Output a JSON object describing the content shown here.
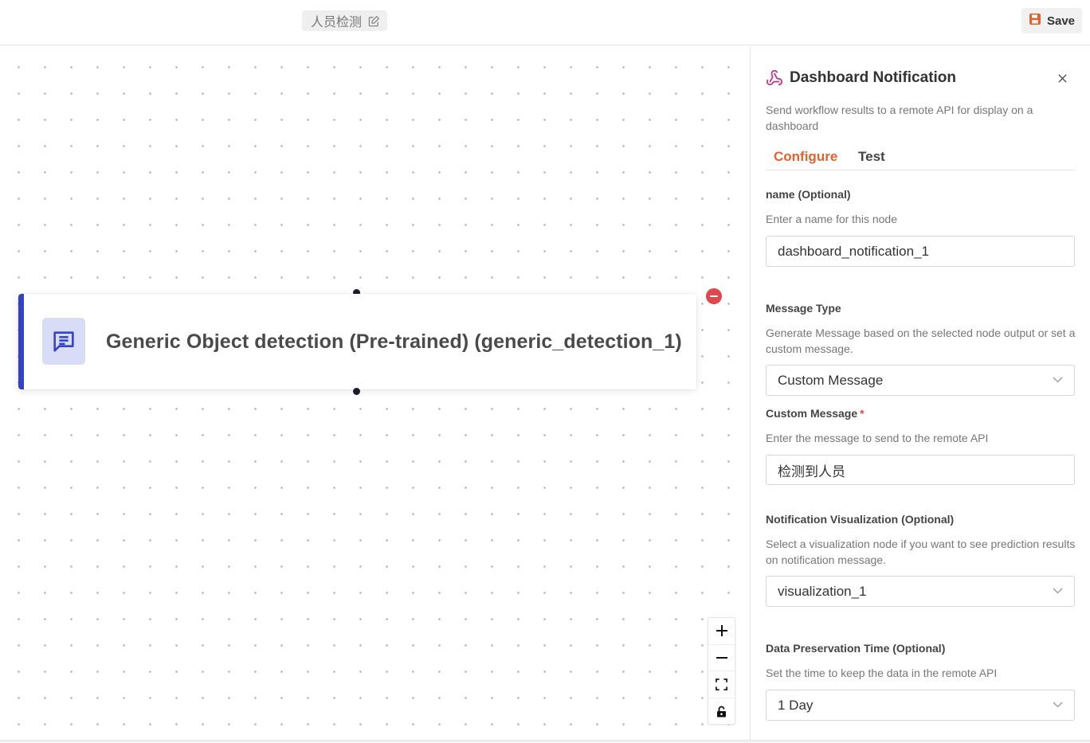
{
  "header": {
    "workflow_title": "人员检测",
    "edit_icon": "edit-icon",
    "save_label": "Save",
    "save_icon": "save-icon"
  },
  "canvas": {
    "node": {
      "label": "Generic Object detection (Pre-trained) (generic_detection_1)",
      "icon": "message-icon",
      "accent_color": "#3242c9"
    },
    "zoom_controls": [
      "zoom-in-icon",
      "zoom-out-icon",
      "fit-view-icon",
      "lock-icon"
    ]
  },
  "panel": {
    "title": "Dashboard Notification",
    "icon": "webhook-icon",
    "description": "Send workflow results to a remote API for display on a dashboard",
    "tabs": [
      {
        "label": "Configure",
        "active": true
      },
      {
        "label": "Test",
        "active": false
      }
    ],
    "accent_color": "#e8612a",
    "fields": {
      "name": {
        "label": "name (Optional)",
        "hint": "Enter a name for this node",
        "value": "dashboard_notification_1"
      },
      "message_type": {
        "label": "Message Type",
        "hint": "Generate Message based on the selected node output or set a custom message.",
        "value": "Custom Message"
      },
      "custom_message": {
        "label": "Custom Message",
        "required_mark": "*",
        "hint": "Enter the message to send to the remote API",
        "value": "检测到人员"
      },
      "visualization": {
        "label": "Notification Visualization (Optional)",
        "hint": "Select a visualization node if you want to see prediction results on notification message.",
        "value": "visualization_1"
      },
      "preservation": {
        "label": "Data Preservation Time (Optional)",
        "hint": "Set the time to keep the data in the remote API",
        "value": "1 Day"
      }
    }
  }
}
